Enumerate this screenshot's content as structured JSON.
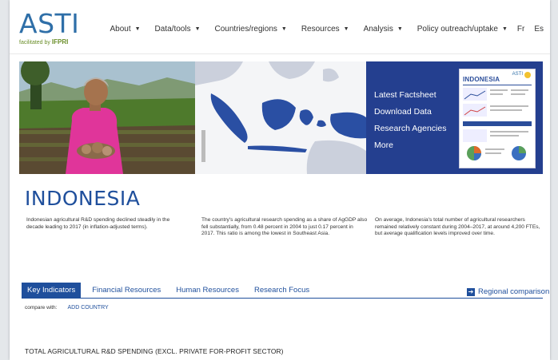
{
  "logo": {
    "word": "ASTI",
    "facilitated": "facilitated by",
    "partner": "IFPRI"
  },
  "nav": {
    "items": [
      {
        "label": "About"
      },
      {
        "label": "Data/tools"
      },
      {
        "label": "Countries/regions"
      },
      {
        "label": "Resources"
      },
      {
        "label": "Analysis"
      },
      {
        "label": "Policy outreach/uptake"
      }
    ],
    "lang_fr": "Fr",
    "lang_es": "Es"
  },
  "hero": {
    "links": [
      "Latest Factsheet",
      "Download Data",
      "Research Agencies",
      "More"
    ],
    "factsheet": {
      "brand": "ASTI",
      "country": "INDONESIA"
    }
  },
  "country": {
    "title": "INDONESIA",
    "descriptions": [
      "Indonesian agricultural R&D spending declined steadily in the decade leading to 2017 (in inflation-adjusted terms).",
      "The country's agricultural research spending as a share of AgGDP also fell substantially, from 0.48 percent in 2004 to just 0.17 percent in 2017. This ratio is among the lowest in Southeast Asia.",
      "On average, Indonesia's total number of agricultural researchers remained relatively constant during 2004–2017, at around 4,200 FTEs, but average qualification levels improved over time."
    ]
  },
  "tabs": [
    "Key Indicators",
    "Financial Resources",
    "Human Resources",
    "Research Focus"
  ],
  "regional_comparison": "Regional comparison",
  "compare": {
    "label": "compare with:",
    "add_country": "ADD COUNTRY"
  },
  "section_title": "TOTAL AGRICULTURAL R&D SPENDING (EXCL. PRIVATE FOR-PROFIT SECTOR)",
  "colors": {
    "brand_blue": "#1f4f9c",
    "panel_blue": "#243f8f",
    "logo_blue": "#2f6fa8",
    "ifpri_green": "#6b8f2a"
  }
}
